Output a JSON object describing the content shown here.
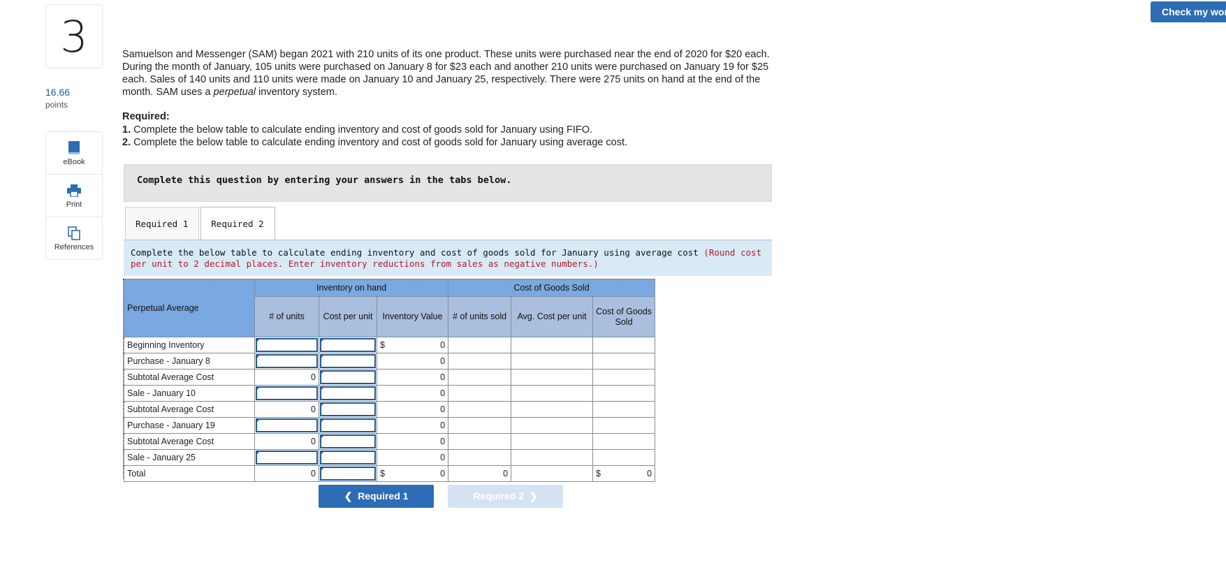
{
  "question_number": "3",
  "points": {
    "value": "16.66",
    "label": "points"
  },
  "tools": [
    {
      "name": "ebook",
      "label": "eBook"
    },
    {
      "name": "print",
      "label": "Print"
    },
    {
      "name": "references",
      "label": "References"
    }
  ],
  "check_button": "Check my work",
  "question": {
    "text_before": "Samuelson and Messenger (SAM) began 2021 with 210 units of its one product. These units were purchased near the end of 2020 for $20 each. During the month of January, 105 units were purchased on January 8 for $23 each and another 210 units were purchased on January 19 for $25 each. Sales of 140 units and 110 units were made on January 10 and January 25, respectively. There were 275 units on hand at the end of the month. SAM uses a ",
    "emphasis": "perpetual",
    "text_after": " inventory system."
  },
  "required": {
    "heading": "Required:",
    "items": [
      {
        "num": "1.",
        "text": " Complete the below table to calculate ending inventory and cost of goods sold for January using FIFO."
      },
      {
        "num": "2.",
        "text": " Complete the below table to calculate ending inventory and cost of goods sold for January using average cost."
      }
    ]
  },
  "instruction": "Complete this question by entering your answers in the tabs below.",
  "tabs": [
    {
      "label": "Required 1",
      "active": false
    },
    {
      "label": "Required 2",
      "active": true
    }
  ],
  "sub_instruction": {
    "text": "Complete the below table to calculate ending inventory and cost of goods sold for January using average cost ",
    "hint": "(Round cost per unit to 2 decimal places. Enter inventory reductions from sales as negative numbers.)"
  },
  "table": {
    "row_header": "Perpetual Average",
    "group_headers": {
      "inventory": "Inventory on hand",
      "cogs": "Cost of Goods Sold"
    },
    "columns": {
      "units": "# of units",
      "cost_per_unit": "Cost per unit",
      "inventory_value": "Inventory Value",
      "units_sold": "# of units sold",
      "avg_cost": "Avg. Cost per unit",
      "cogs": "Cost of Goods Sold"
    },
    "currency": "$",
    "rows": [
      {
        "label": "Beginning Inventory",
        "units": "",
        "inv_value": "0"
      },
      {
        "label": "Purchase - January 8",
        "units": "",
        "inv_value": "0"
      },
      {
        "label": "Subtotal Average Cost",
        "units": "0",
        "inv_value": "0"
      },
      {
        "label": "Sale - January 10",
        "units": "",
        "inv_value": "0"
      },
      {
        "label": "Subtotal Average Cost",
        "units": "0",
        "inv_value": "0"
      },
      {
        "label": "Purchase - January 19",
        "units": "",
        "inv_value": "0"
      },
      {
        "label": "Subtotal Average Cost",
        "units": "0",
        "inv_value": "0"
      },
      {
        "label": "Sale - January 25",
        "units": "",
        "inv_value": "0"
      }
    ],
    "total": {
      "label": "Total",
      "units": "0",
      "inv_value": "0",
      "units_sold": "0",
      "cogs": "0"
    }
  },
  "nav": {
    "prev": "Required 1",
    "next": "Required 2"
  },
  "colors": {
    "accent": "#2d6db5",
    "hint": "#b0182a",
    "header_blue": "#7aa8e0",
    "highlight": "#fcf9b1"
  }
}
